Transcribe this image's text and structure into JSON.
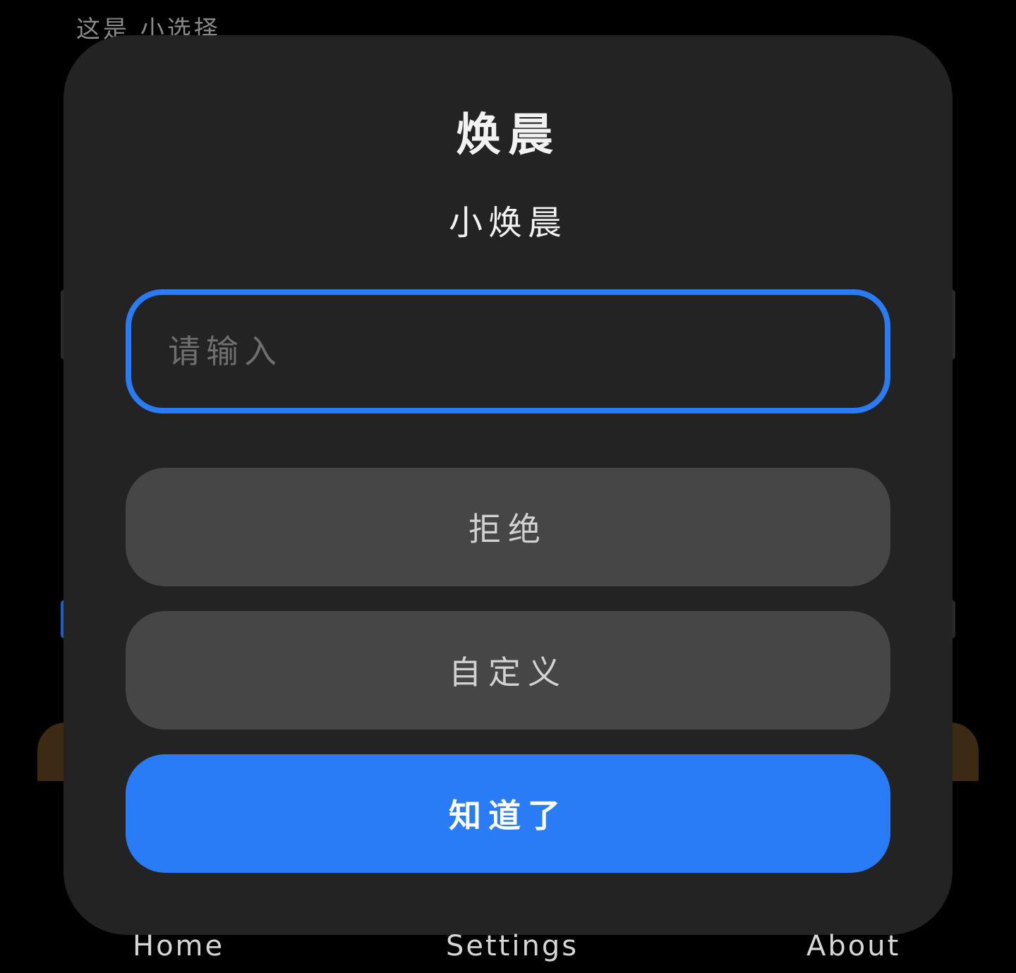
{
  "background": {
    "label": "这是 小选择"
  },
  "dialog": {
    "title": "焕晨",
    "subtitle": "小焕晨",
    "input": {
      "placeholder": "请输入",
      "value": ""
    },
    "buttons": {
      "reject": "拒绝",
      "custom": "自定义",
      "ok": "知道了"
    },
    "colors": {
      "accent": "#2a7cf6",
      "surface": "#232323",
      "button_secondary": "#464646"
    }
  },
  "bottom_nav": {
    "home": "Home",
    "settings": "Settings",
    "about": "About"
  }
}
